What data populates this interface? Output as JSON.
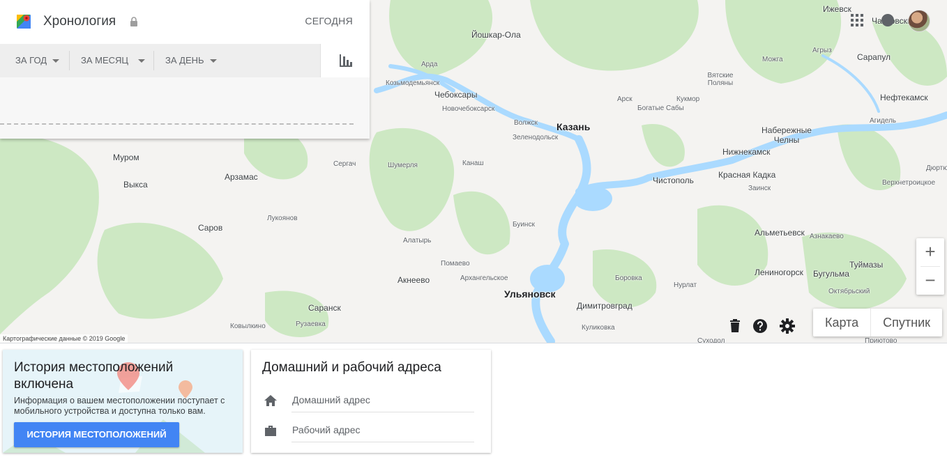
{
  "app": {
    "title": "Хронология",
    "today_label": "СЕГОДНЯ"
  },
  "filters": [
    {
      "label": "ЗА ГОД"
    },
    {
      "label": "ЗА МЕСЯЦ"
    },
    {
      "label": "ЗА ДЕНЬ"
    }
  ],
  "map": {
    "attribution": "Картографические данные © 2019 Google",
    "type_map": "Карта",
    "type_satellite": "Спутник",
    "zoom_in": "+",
    "zoom_out": "−",
    "colors": {
      "land": "#f4f3f1",
      "forest": "#cde8c3",
      "water": "#aadaff"
    },
    "cities": {
      "izhevsk": "Ижевск",
      "chaikovsky": "Чайковский",
      "yoshkarola": "Йошкар-Ола",
      "arda": "Арда",
      "kozmodemyansk": "Козьмодемьянск",
      "cheboksary": "Чебоксары",
      "novocheboksarsk": "Новочебоксарск",
      "volzhsk": "Волжск",
      "kazan": "Казань",
      "zelenodolsk": "Зеленодольск",
      "agryz": "Агрыз",
      "mozhga": "Можга",
      "sarapul": "Сарапул",
      "vyatskie_polyany": "Вятские Поляны",
      "arsk": "Арск",
      "kukmor": "Кукмор",
      "bogatye_saby": "Богатые Сабы",
      "neftekamsk": "Нефтекамск",
      "agidel": "Агидель",
      "nab_chelny": "Набережные Челны",
      "nizhnekamsk": "Нижнекамск",
      "krasnaya_kadka": "Красная Кадка",
      "zainsk": "Заинск",
      "dyurtyuli": "Дюртю",
      "verkhnetrop": "Верхнетроицкое",
      "murom": "Муром",
      "vyksa": "Выкса",
      "arzamas": "Арзамас",
      "sergach": "Сергач",
      "shumerlya": "Шумерля",
      "kanash": "Канаш",
      "chistopol": "Чистополь",
      "sarov": "Саров",
      "lukoyanov": "Лукоянов",
      "buinsk": "Буинск",
      "almetyevsk": "Альметьевск",
      "aznakaevo": "Азнакаево",
      "alatyr": "Алатырь",
      "pomaevo": "Помаево",
      "arkhangelskoe": "Архангельское",
      "akneevo": "Акнеево",
      "ulyanovsk": "Ульяновск",
      "borovka": "Боровка",
      "nurlat": "Нурлат",
      "leninogorsk": "Лениногорск",
      "bugulma": "Бугульма",
      "tuymazy": "Туймазы",
      "oktyabrsky": "Октябрьский",
      "saransk": "Саранск",
      "dimitrovgrad": "Димитровград",
      "kovylkino": "Ковылкино",
      "ruzaevka": "Рузаевка",
      "kulikovka": "Куликовка",
      "sukhodol": "Суходол",
      "prityovo": "Приютово"
    }
  },
  "history_card": {
    "title": "История местоположений включена",
    "text": "Информация о вашем местоположении поступает с мобильного устройства и доступна только вам.",
    "button": "ИСТОРИЯ МЕСТОПОЛОЖЕНИЙ"
  },
  "address_card": {
    "title": "Домашний и рабочий адреса",
    "home": "Домашний адрес",
    "work": "Рабочий адрес"
  },
  "icons": [
    "maps-logo-icon",
    "lock-icon",
    "bar-chart-icon",
    "apps-grid-icon",
    "account-icon",
    "trash-icon",
    "help-icon",
    "settings-icon",
    "home-icon",
    "briefcase-icon"
  ]
}
